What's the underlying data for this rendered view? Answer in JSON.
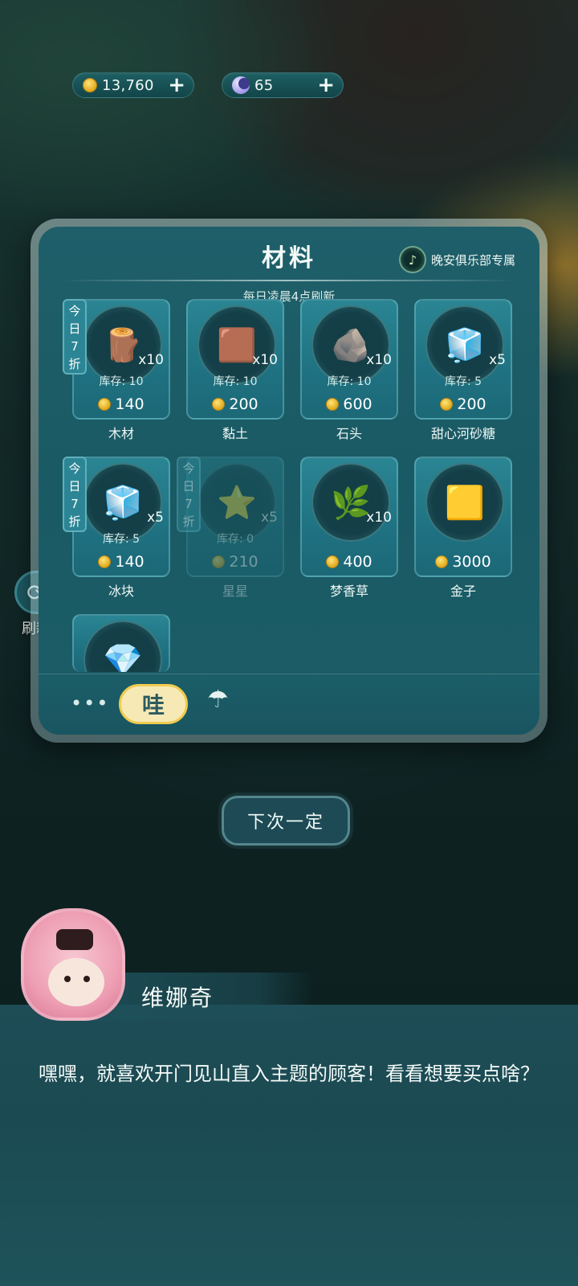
{
  "currency": {
    "coins": "13,760",
    "moons": "65",
    "add_label": "+"
  },
  "shop": {
    "title": "材料",
    "club_label": "晚安俱乐部专属",
    "refresh_note": "每日凌晨4点刷新",
    "items": [
      {
        "name": "木材",
        "qty": "x10",
        "stock": "库存: 10",
        "price": "140",
        "discount": [
          "今",
          "日",
          "7",
          "折"
        ],
        "icon": "🪵"
      },
      {
        "name": "黏土",
        "qty": "x10",
        "stock": "库存: 10",
        "price": "200",
        "discount": null,
        "icon": "🟫"
      },
      {
        "name": "石头",
        "qty": "x10",
        "stock": "库存: 10",
        "price": "600",
        "discount": null,
        "icon": "🪨"
      },
      {
        "name": "甜心河砂糖",
        "qty": "x5",
        "stock": "库存: 5",
        "price": "200",
        "discount": null,
        "icon": "🧊"
      },
      {
        "name": "冰块",
        "qty": "x5",
        "stock": "库存: 5",
        "price": "140",
        "discount": [
          "今",
          "日",
          "7",
          "折"
        ],
        "icon": "🧊"
      },
      {
        "name": "星星",
        "qty": "x5",
        "stock": "库存: 0",
        "price": "210",
        "discount": [
          "今",
          "日",
          "7",
          "折"
        ],
        "icon": "⭐"
      },
      {
        "name": "梦香草",
        "qty": "x10",
        "stock": "",
        "price": "400",
        "discount": null,
        "icon": "🌿"
      },
      {
        "name": "金子",
        "qty": "",
        "stock": "",
        "price": "3000",
        "discount": null,
        "icon": "🟨"
      },
      {
        "name": "",
        "qty": "",
        "stock": "",
        "price": "",
        "discount": null,
        "icon": "💎"
      }
    ],
    "tabs": {
      "more": "•••",
      "active": "哇",
      "food": "⌒"
    }
  },
  "refresh_button": {
    "label": "刷新",
    "icon": "refresh-icon"
  },
  "next_button": {
    "label": "下次一定"
  },
  "dialog": {
    "npc_name": "维娜奇",
    "text": "嘿嘿，就喜欢开门见山直入主题的顾客！看看想要买点啥？"
  },
  "colors": {
    "panel": "#1b5d67",
    "card": "#2a8593",
    "tab_active_bg": "#f6e9b6",
    "tab_active_border": "#f0cb4e",
    "dialog_bg": "#1f4d57"
  }
}
